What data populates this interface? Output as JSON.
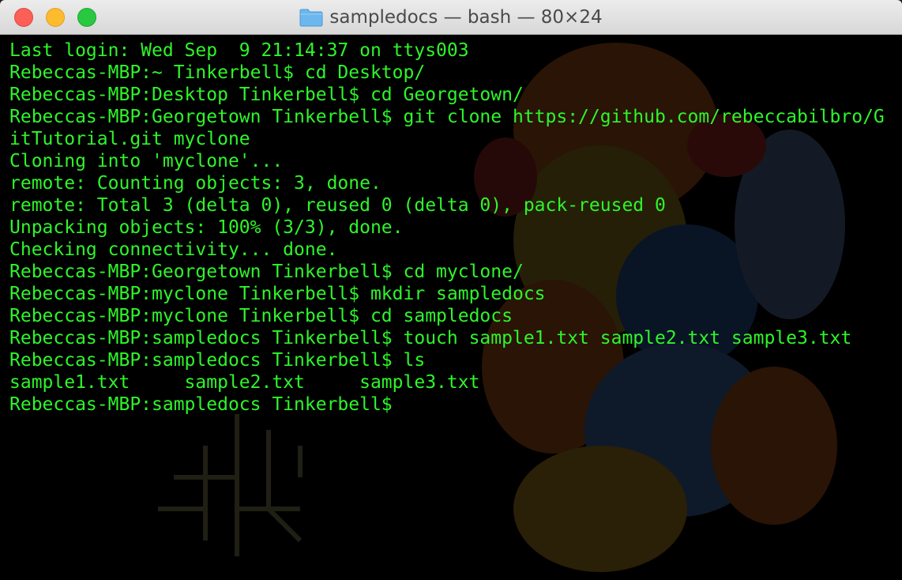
{
  "window": {
    "title": "sampledocs — bash — 80×24",
    "folder_icon": "folder-icon"
  },
  "colors": {
    "terminal_text": "#2ef52a",
    "terminal_bg": "#000000",
    "close": "#fc5f57",
    "minimize": "#fdbc2e",
    "zoom": "#28c840"
  },
  "terminal": {
    "lines": [
      "Last login: Wed Sep  9 21:14:37 on ttys003",
      "Rebeccas-MBP:~ Tinkerbell$ cd Desktop/",
      "Rebeccas-MBP:Desktop Tinkerbell$ cd Georgetown/",
      "Rebeccas-MBP:Georgetown Tinkerbell$ git clone https://github.com/rebeccabilbro/G",
      "itTutorial.git myclone",
      "Cloning into 'myclone'...",
      "remote: Counting objects: 3, done.",
      "remote: Total 3 (delta 0), reused 0 (delta 0), pack-reused 0",
      "Unpacking objects: 100% (3/3), done.",
      "Checking connectivity... done.",
      "Rebeccas-MBP:Georgetown Tinkerbell$ cd myclone/",
      "Rebeccas-MBP:myclone Tinkerbell$ mkdir sampledocs",
      "Rebeccas-MBP:myclone Tinkerbell$ cd sampledocs",
      "Rebeccas-MBP:sampledocs Tinkerbell$ touch sample1.txt sample2.txt sample3.txt",
      "Rebeccas-MBP:sampledocs Tinkerbell$ ls",
      "sample1.txt     sample2.txt     sample3.txt",
      "Rebeccas-MBP:sampledocs Tinkerbell$"
    ]
  }
}
